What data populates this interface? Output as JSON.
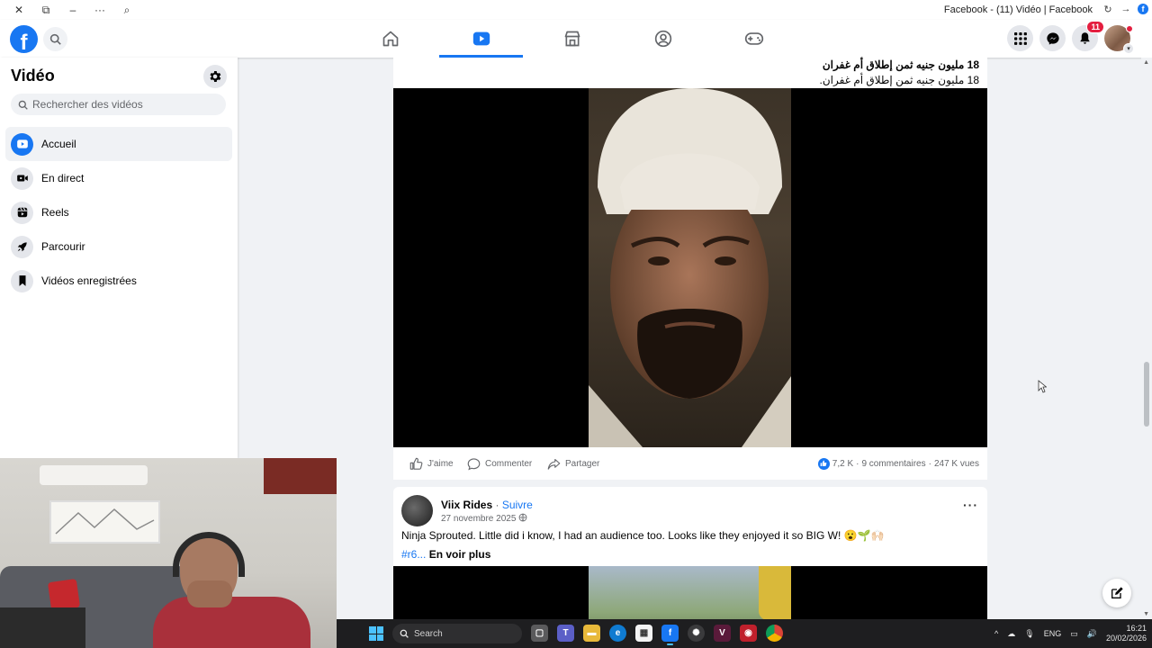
{
  "browser": {
    "title": "Facebook - (11) Vidéo | Facebook",
    "controls": [
      "close",
      "restore",
      "minimize",
      "more",
      "zoom"
    ]
  },
  "topnav": {
    "logo": "f",
    "notifications_badge": "11",
    "tabs": [
      {
        "name": "home",
        "active": false
      },
      {
        "name": "video",
        "active": true
      },
      {
        "name": "marketplace",
        "active": false
      },
      {
        "name": "groups",
        "active": false
      },
      {
        "name": "gaming",
        "active": false
      }
    ]
  },
  "sidebar": {
    "title": "Vidéo",
    "search_placeholder": "Rechercher des vidéos",
    "items": [
      {
        "label": "Accueil",
        "icon": "play-icon",
        "active": true
      },
      {
        "label": "En direct",
        "icon": "live-camera-icon",
        "active": false
      },
      {
        "label": "Reels",
        "icon": "reels-icon",
        "active": false
      },
      {
        "label": "Parcourir",
        "icon": "rocket-icon",
        "active": false
      },
      {
        "label": "Vidéos enregistrées",
        "icon": "bookmark-icon",
        "active": false
      }
    ]
  },
  "post1": {
    "caption_line1": "18 مليون جنيه ثمن إطلاق أم غفران",
    "caption_line2": "18 مليون جنيه ثمن إطلاق أم غفران.",
    "actions": {
      "like": "J'aime",
      "comment": "Commenter",
      "share": "Partager"
    },
    "reactions": "7,2 K",
    "comments": "9 commentaires",
    "views": "247 K vues",
    "separator": "·"
  },
  "post2": {
    "author": "Viix Rides",
    "follow": "Suivre",
    "separator": "·",
    "date": "27 novembre 2025",
    "text": "Ninja Sprouted. Little did i know, I had an audience too. Looks like they enjoyed it so BIG W! 😮🌱🙌🏻",
    "hashtag": "#r6...",
    "see_more": "En voir plus"
  },
  "taskbar": {
    "search_placeholder": "Search",
    "language": "ENG",
    "time": "16:21",
    "date": "20/02/2026",
    "tray_chevron": "^"
  },
  "colors": {
    "accent": "#1877f2",
    "badge": "#e41e3f",
    "background": "#f0f2f5"
  }
}
